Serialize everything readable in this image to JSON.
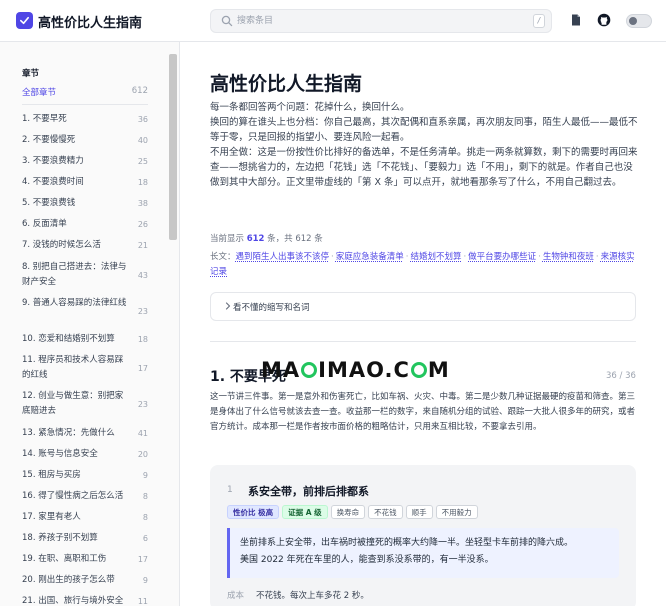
{
  "header": {
    "title": "高性价比人生指南",
    "search_placeholder": "搜索条目",
    "search_shortcut": "/"
  },
  "sidebar": {
    "heading": "章节",
    "all": {
      "label": "全部章节",
      "count": "612"
    },
    "items": [
      {
        "label": "1. 不要早死",
        "count": "36"
      },
      {
        "label": "2. 不要慢慢死",
        "count": "40"
      },
      {
        "label": "3. 不要浪费精力",
        "count": "25"
      },
      {
        "label": "4. 不要浪费时间",
        "count": "18"
      },
      {
        "label": "5. 不要浪费钱",
        "count": "38"
      },
      {
        "label": "6. 反面清单",
        "count": "26"
      },
      {
        "label": "7. 没钱的时候怎么活",
        "count": "21"
      },
      {
        "label": "8. 别把自己搭进去：法律与财产安全",
        "count": "43"
      },
      {
        "label": "9. 普通人容易踩的法律红线",
        "count": "23"
      },
      {
        "label": "10. 恋爱和结婚别不划算",
        "count": "18"
      },
      {
        "label": "11. 程序员和技术人容易踩的红线",
        "count": "17"
      },
      {
        "label": "12. 创业与做生意：别把家底赔进去",
        "count": "23"
      },
      {
        "label": "13. 紧急情况：先做什么",
        "count": "41"
      },
      {
        "label": "14. 账号与信息安全",
        "count": "20"
      },
      {
        "label": "15. 租房与买房",
        "count": "9"
      },
      {
        "label": "16. 得了慢性病之后怎么活",
        "count": "8"
      },
      {
        "label": "17. 家里有老人",
        "count": "8"
      },
      {
        "label": "18. 养孩子别不划算",
        "count": "6"
      },
      {
        "label": "19. 在职、离职和工伤",
        "count": "17"
      },
      {
        "label": "20. 刚出生的孩子怎么带",
        "count": "9"
      },
      {
        "label": "21. 出国、旅行与境外安全",
        "count": "11"
      }
    ]
  },
  "main": {
    "title": "高性价比人生指南",
    "intro": [
      "每一条都回答两个问题：花掉什么，换回什么。",
      "换回的算在谁头上也分档：你自己最高，其次配偶和直系亲属，再次朋友同事，陌生人最低——最低不等于零，只是回报的指望小、要连风险一起看。",
      "不用全做：这是一份按性价比排好的备选单，不是任务清单。挑走一两条就算数，剩下的需要时再回来查——想挑省力的，左边把「花钱」选「不花钱」、「要毅力」选「不用」，剩下的就是。作者自己也没做到其中大部分。正文里带虚线的「第 X 条」可以点开，就地看那条写了什么，不用自己翻过去。"
    ],
    "stats": {
      "prefix": "当前显示 ",
      "shown": "612",
      "suffix": " 条，共 612 条"
    },
    "links": {
      "label": "长文：",
      "items": [
        "遇到陌生人出事该不该停",
        "家庭应急装备清单",
        "结婚划不划算",
        "做平台要办哪些证",
        "生物钟和夜班",
        "来源核实记录"
      ]
    },
    "glossary": "看不懂的缩写和名词",
    "section": {
      "title": "1. 不要早死",
      "count": "36 / 36",
      "desc": "这一节讲三件事。第一是意外和伤害死亡，比如车祸、火灾、中毒。第二是少数几种证据最硬的疫苗和筛查。第三是身体出了什么信号就该去查一查。收益那一栏的数字，来自随机分组的试验、跟踪一大批人很多年的研究，或者官方统计。成本那一栏是作者按市面价格的粗略估计，只用来互相比较，不要拿去引用。"
    },
    "card": {
      "num": "1",
      "title": "系安全带，前排后排都系",
      "tags": [
        "性价比 极高",
        "证据 A 级",
        "换寿命",
        "不花钱",
        "顺手",
        "不用毅力"
      ],
      "quote": [
        "坐前排系上安全带，出车祸时被撞死的概率大约降一半。坐轻型卡车前排的降六成。",
        "美国 2022 年死在车里的人，能查到系没系带的，有一半没系。"
      ],
      "cost_label": "成本",
      "cost_value": "不花钱。每次上车多花 2 秒。"
    }
  },
  "watermark": "MAIQIMAO.COM",
  "colors": {
    "accent": "#4f46e5",
    "evidence": "#16a34a",
    "watermark_ring": "#22c55e"
  }
}
